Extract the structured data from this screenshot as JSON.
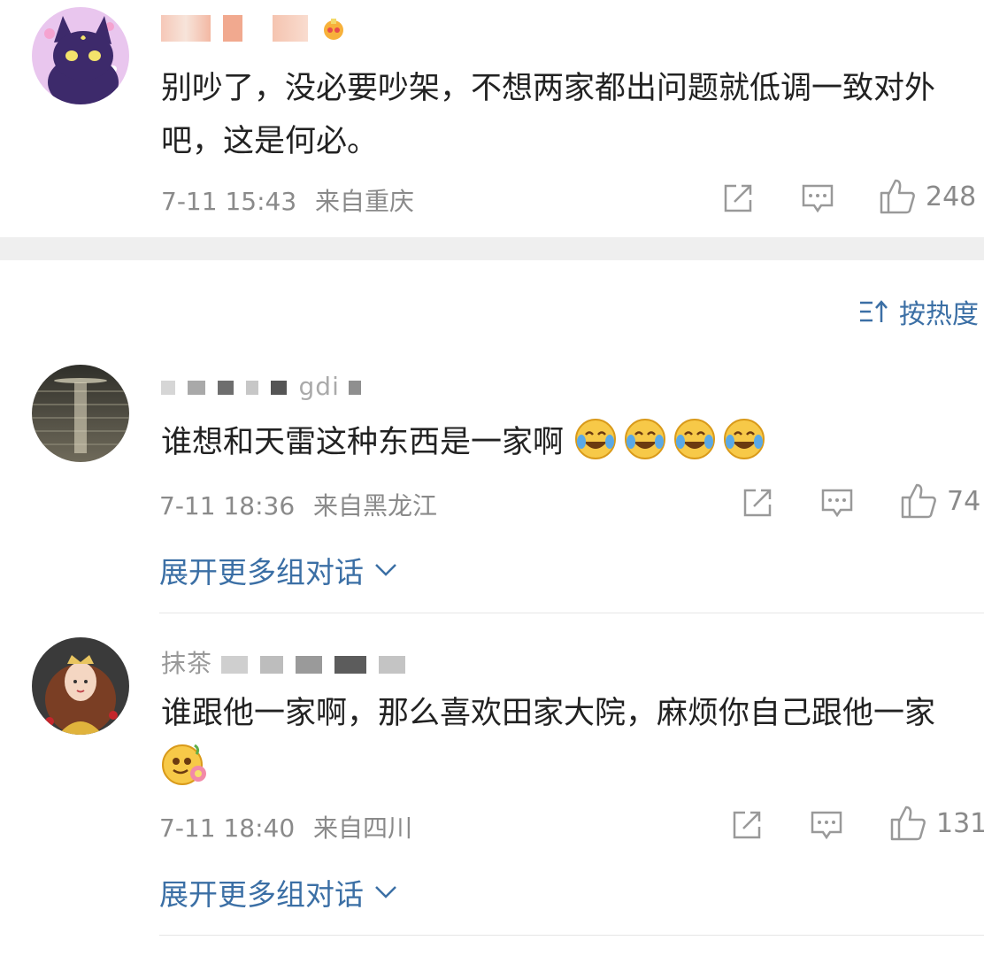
{
  "comments": [
    {
      "username": "",
      "text": "别吵了，没必要吵架，不想两家都出问题就低调一致对外吧，这是何必。",
      "time": "7-11 15:43",
      "location": "来自重庆",
      "likes": "248"
    },
    {
      "username": "gdi",
      "text": "谁想和天雷这种东西是一家啊",
      "time": "7-11 18:36",
      "location": "来自黑龙江",
      "likes": "74",
      "expand": "展开更多组对话"
    },
    {
      "username": "抹茶",
      "text": "谁跟他一家啊，那么喜欢田家大院，麻烦你自己跟他一家",
      "time": "7-11 18:40",
      "location": "来自四川",
      "likes": "131",
      "expand": "展开更多组对话"
    }
  ],
  "sort": {
    "label": "按热度"
  },
  "colors": {
    "link": "#3b6fa5",
    "meta": "#8a8a8a",
    "divider": "#efefef"
  }
}
